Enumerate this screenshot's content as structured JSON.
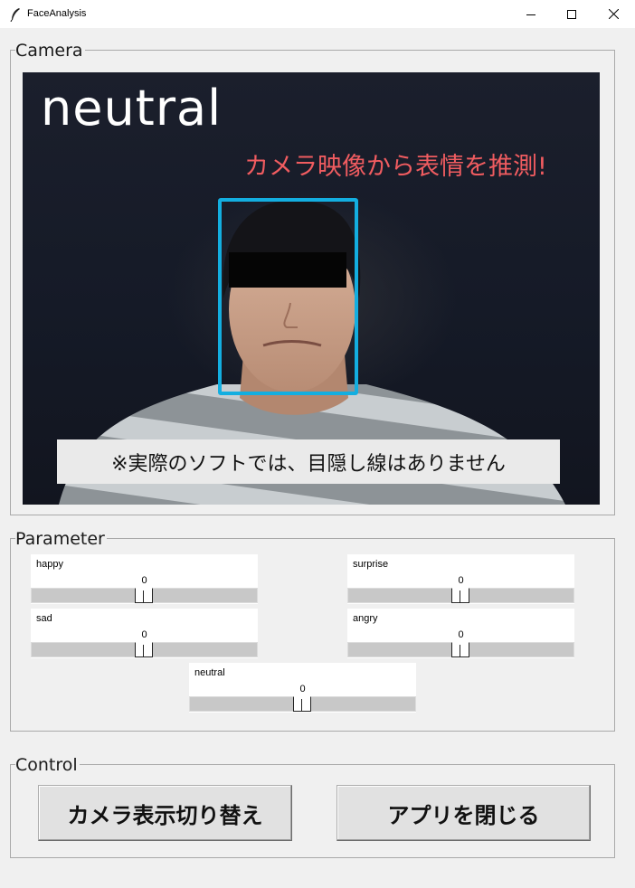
{
  "window": {
    "title": "FaceAnalysis",
    "controls": {
      "minimize": "minimize-icon",
      "maximize": "maximize-icon",
      "close": "close-icon"
    }
  },
  "camera": {
    "frame_label": "Camera",
    "emotion_label": "neutral",
    "headline": "カメラ映像から表情を推測!",
    "notice": "※実際のソフトでは、目隠し線はありません",
    "colors": {
      "face_box": "#13aee0",
      "headline": "#f05c60"
    }
  },
  "parameter": {
    "frame_label": "Parameter",
    "sliders": [
      {
        "name": "happy",
        "value": "0"
      },
      {
        "name": "surprise",
        "value": "0"
      },
      {
        "name": "sad",
        "value": "0"
      },
      {
        "name": "angry",
        "value": "0"
      },
      {
        "name": "neutral",
        "value": "0"
      }
    ]
  },
  "control": {
    "frame_label": "Control",
    "toggle_camera": "カメラ表示切り替え",
    "close_app": "アプリを閉じる"
  }
}
